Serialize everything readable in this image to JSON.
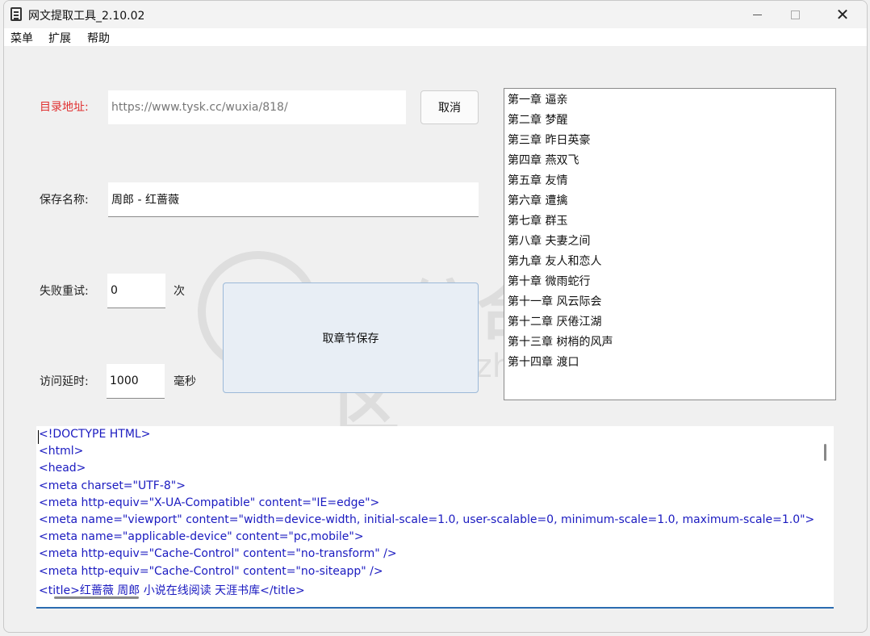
{
  "window": {
    "title": "网文提取工具_2.10.02"
  },
  "menu": [
    "菜单",
    "扩展",
    "帮助"
  ],
  "form": {
    "url_label": "目录地址:",
    "url_value": "https://www.tysk.cc/wuxia/818/",
    "cancel_label": "取消",
    "save_name_label": "保存名称:",
    "save_name_value": "周郎 - 红蔷薇",
    "retry_label": "失败重试:",
    "retry_value": "0",
    "retry_unit": "次",
    "delay_label": "访问延时:",
    "delay_value": "1000",
    "delay_unit": "毫秒",
    "fetch_button": "取章节保存"
  },
  "chapters": [
    "第一章 逼亲",
    "第二章 梦醒",
    "第三章 昨日英豪",
    "第四章 燕双飞",
    "第五章 友情",
    "第六章 遭擒",
    "第七章 群玉",
    "第八章 夫妻之间",
    "第九章 友人和恋人",
    "第十章 微雨蛇行",
    "第十一章 风云际会",
    "第十二章 厌倦江湖",
    "第十三章 树梢的风声",
    "第十四章 渡口"
  ],
  "html_source": [
    "<!DOCTYPE HTML>",
    "<html>",
    "<head>",
    "<meta charset=\"UTF-8\">",
    "<meta http-equiv=\"X-UA-Compatible\" content=\"IE=edge\">",
    "<meta name=\"viewport\" content=\"width=device-width, initial-scale=1.0, user-scalable=0, minimum-scale=1.0, maximum-scale=1.0\">",
    "<meta name=\"applicable-device\" content=\"pc,mobile\">",
    "<meta http-equiv=\"Cache-Control\" content=\"no-transform\" />",
    "<meta http-equiv=\"Cache-Control\" content=\"no-siteapp\" />",
    "<title>红蔷薇 周郎 小说在线阅读 天涯书库</title>"
  ],
  "watermark": {
    "text": "i3综合社区",
    "url": "www.i3zh.com"
  }
}
